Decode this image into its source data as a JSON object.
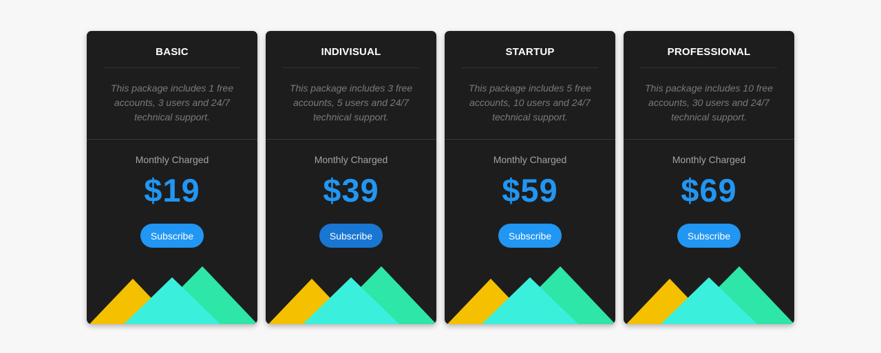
{
  "plans": [
    {
      "name": "BASIC",
      "description": "This package includes 1 free accounts, 3 users and 24/7 technical support.",
      "billing_label": "Monthly Charged",
      "price": "$19",
      "button_label": "Subscribe",
      "button_state": "default"
    },
    {
      "name": "INDIVISUAL",
      "description": "This package includes 3 free accounts, 5 users and 24/7 technical support.",
      "billing_label": "Monthly Charged",
      "price": "$39",
      "button_label": "Subscribe",
      "button_state": "hover"
    },
    {
      "name": "STARTUP",
      "description": "This package includes 5 free accounts, 10 users and 24/7 technical support.",
      "billing_label": "Monthly Charged",
      "price": "$59",
      "button_label": "Subscribe",
      "button_state": "default"
    },
    {
      "name": "PROFESSIONAL",
      "description": "This package includes 10 free accounts, 30 users and 24/7 technical support.",
      "billing_label": "Monthly Charged",
      "price": "$69",
      "button_label": "Subscribe",
      "button_state": "default"
    }
  ],
  "colors": {
    "card_background": "#1d1d1d",
    "page_background": "#f7f7f7",
    "price_accent": "#2196f3",
    "button": "#2196f3",
    "button_hover": "#1976d2",
    "mountain_yellow": "#f5c000",
    "mountain_green": "#2ee6a8",
    "mountain_cyan": "#3af0dc"
  }
}
